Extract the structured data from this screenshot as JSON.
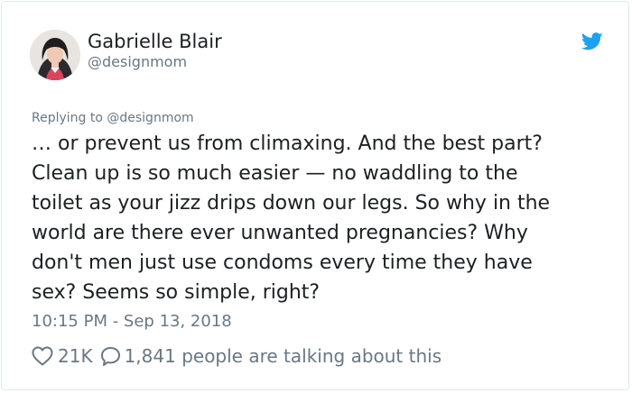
{
  "author": {
    "name": "Gabrielle Blair",
    "handle": "@designmom"
  },
  "replying_to": "Replying to @designmom",
  "tweet": {
    "lines": [
      "… or prevent us from climaxing. And the best part?",
      "Clean up is so much easier — no waddling to the",
      "toilet as your jizz drips down our legs. So why in the",
      "world are there ever unwanted pregnancies? Why",
      "don't men just use condoms every time they have",
      "sex? Seems so simple, right?"
    ]
  },
  "timestamp": "10:15 PM - Sep 13, 2018",
  "actions": {
    "likes": "21K",
    "talking": "1,841 people are talking about this"
  },
  "icons": {
    "brand": "twitter-bird-icon",
    "like": "heart-icon",
    "reply": "speech-bubble-icon"
  },
  "colors": {
    "twitter_blue": "#1da1f2",
    "secondary_text": "#697882",
    "primary_text": "#1c2022",
    "border": "#e1e8ed"
  }
}
